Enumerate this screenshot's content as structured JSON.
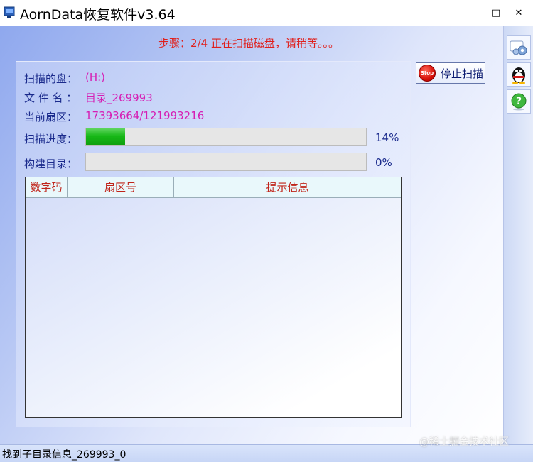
{
  "window": {
    "title": "AornData恢复软件v3.64",
    "minimize_glyph": "–",
    "maximize_glyph": "□",
    "close_glyph": "✕"
  },
  "step": {
    "text": "步骤：2/4 正在扫描磁盘，请稍等。。。"
  },
  "scan": {
    "disk_label": "扫描的盘：",
    "disk_value": "(H:)",
    "file_label": "文 件 名 ：",
    "file_value": "目录_269993",
    "sector_label": "当前扇区：",
    "sector_value": "17393664/121993216",
    "progress_label": "扫描进度：",
    "progress_text": "14%",
    "progress_value": 14,
    "build_label": "构建目录：",
    "build_text": "0%",
    "build_value": 0
  },
  "table": {
    "columns": [
      "数字码",
      "扇区号",
      "提示信息"
    ],
    "rows": []
  },
  "stop_button": {
    "icon_text": "Stop",
    "label": "停止扫描"
  },
  "sidebar": {
    "tools": [
      "settings-gear-icon",
      "qq-penguin-icon",
      "help-question-icon"
    ]
  },
  "status": {
    "text": "找到子目录信息_269993_0"
  },
  "watermark": {
    "text": "@稀土掘金技术社区"
  }
}
